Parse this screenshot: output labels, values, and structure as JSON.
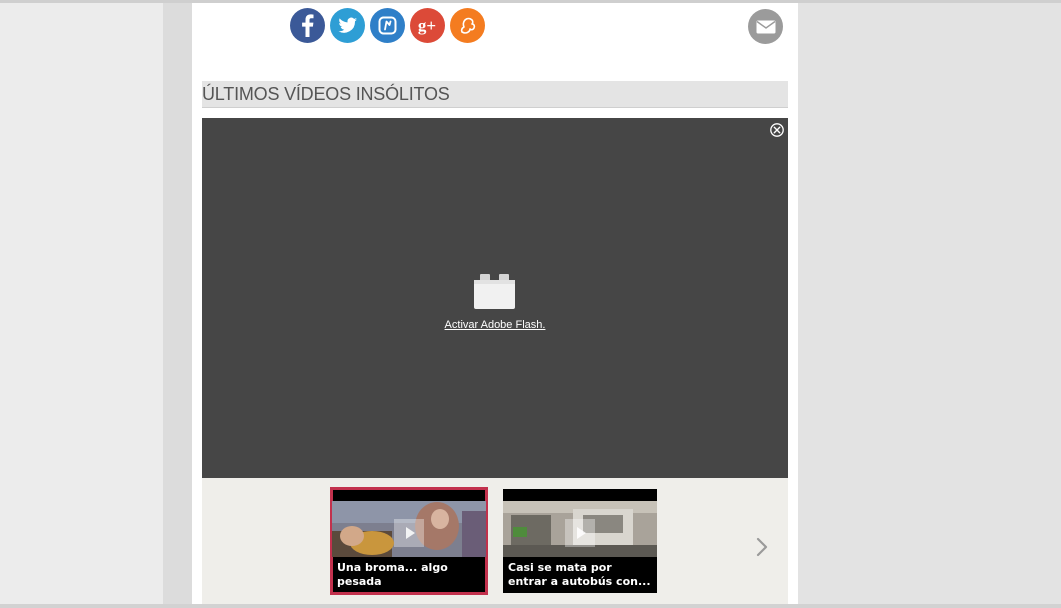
{
  "share": {
    "facebook_color": "#3b5998",
    "twitter_color": "#2e9ed5",
    "meneame_color": "#2f7fc8",
    "googleplus_color": "#dc4a38",
    "fifth_color": "#f47c20",
    "email_color": "#9b9b9b",
    "googleplus_label": "g+"
  },
  "section": {
    "title": "ÚLTIMOS VÍDEOS INSÓLITOS"
  },
  "player": {
    "flash_link": "Activar Adobe Flash."
  },
  "carousel": {
    "active_border_color": "#c2314d",
    "items": [
      {
        "caption": "Una broma... algo pesada"
      },
      {
        "caption": "Casi se mata por entrar a autobús con..."
      }
    ]
  }
}
